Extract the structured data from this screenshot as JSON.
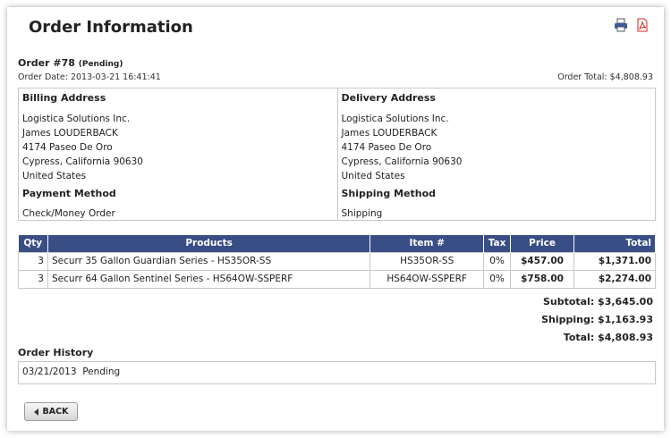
{
  "page": {
    "title": "Order Information"
  },
  "toolbar": {
    "print_icon": "printer-icon",
    "pdf_icon": "pdf-icon"
  },
  "order": {
    "number_label": "Order #78",
    "status": "(Pending)",
    "date": "Order Date: 2013-03-21 16:41:41",
    "total": "Order Total: $4,808.93"
  },
  "billing": {
    "title": "Billing Address",
    "lines": [
      "Logistica Solutions Inc.",
      "James LOUDERBACK",
      "4174 Paseo De Oro",
      "Cypress, California 90630",
      "United States"
    ]
  },
  "delivery": {
    "title": "Delivery Address",
    "lines": [
      "Logistica Solutions Inc.",
      "James LOUDERBACK",
      "4174 Paseo De Oro",
      "Cypress, California 90630",
      "United States"
    ]
  },
  "payment": {
    "title": "Payment Method",
    "value": "Check/Money Order"
  },
  "shipping_method": {
    "title": "Shipping Method",
    "value": "Shipping"
  },
  "table": {
    "headers": [
      "Qty",
      "Products",
      "Item #",
      "Tax",
      "Price",
      "Total"
    ],
    "rows": [
      [
        "3",
        "Securr 35 Gallon Guardian Series - HS35OR-SS",
        "HS35OR-SS",
        "0%",
        "$457.00",
        "$1,371.00"
      ],
      [
        "3",
        "Securr 64 Gallon Sentinel Series - HS64OW-SSPERF",
        "HS64OW-SSPERF",
        "0%",
        "$758.00",
        "$2,274.00"
      ]
    ]
  },
  "totals": {
    "subtotal": "Subtotal: $3,645.00",
    "shipping": "Shipping: $1,163.93",
    "total": "Total: $4,808.93"
  },
  "history": {
    "title": "Order History",
    "entry": "03/21/2013  Pending"
  },
  "back_label": "BACK",
  "colors": {
    "header_bg": "#3a4e86",
    "pdf_red": "#d52b1e"
  }
}
